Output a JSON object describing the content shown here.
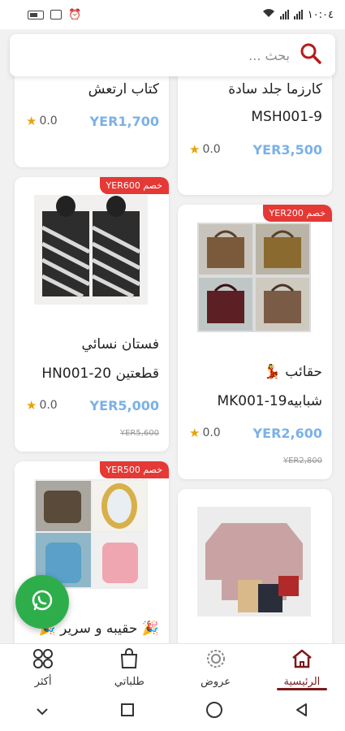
{
  "status_bar": {
    "time": "١٠:٠٤"
  },
  "search": {
    "placeholder": "بحث ..."
  },
  "products": [
    {
      "title": "كتاب ارتعش",
      "price": "YER1,700",
      "rating": "0.0"
    },
    {
      "title_line1": "كارزما جلد سادة",
      "title_line2": "MSH001-9",
      "price": "YER3,500",
      "rating": "0.0"
    },
    {
      "badge": "خصم YER600",
      "title_line1": "فستان نسائي",
      "title_line2": "قطعتين HN001-20",
      "price": "YER5,000",
      "rating": "0.0",
      "old_price": "YER5,600"
    },
    {
      "badge": "خصم YER200",
      "title_line1": "حقائب 💃",
      "title_line2": "شبابيهMK001-19",
      "price": "YER2,600",
      "rating": "0.0",
      "old_price": "YER2,800"
    },
    {
      "badge": "خصم YER500",
      "title_line1": "🎉 حقيبه و سرير 🎉"
    },
    {}
  ],
  "bottom_nav": [
    {
      "label": "أكثر"
    },
    {
      "label": "طلباتي"
    },
    {
      "label": "عروض"
    },
    {
      "label": "الرئيسية",
      "active": true
    }
  ],
  "colors": {
    "accent": "#7a1a1a",
    "price": "#7bb1e6",
    "badge": "#e53935",
    "whatsapp": "#2eae4b",
    "star": "#e8a20a"
  }
}
